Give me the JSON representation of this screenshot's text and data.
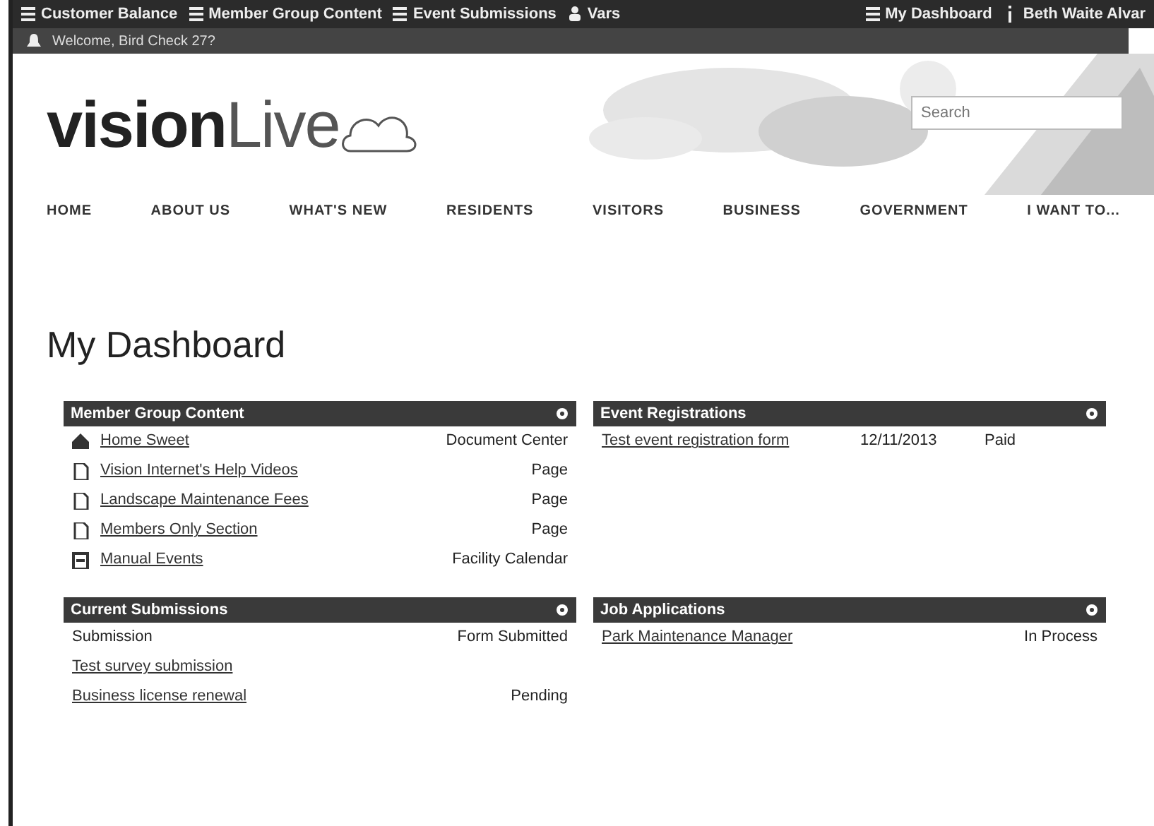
{
  "top_bar": {
    "left_links": [
      {
        "label": "Customer Balance"
      },
      {
        "label": "Member Group Content"
      },
      {
        "label": "Event Submissions"
      },
      {
        "label": "Vars"
      }
    ],
    "right_links": [
      {
        "label": "My Dashboard"
      },
      {
        "label": "Beth Waite Alvar"
      }
    ]
  },
  "notice_bar": {
    "text": "Welcome, Bird Check 27?"
  },
  "header": {
    "logo_bold": "vision",
    "logo_light": "Live",
    "search": {
      "placeholder": "Search"
    }
  },
  "nav": [
    {
      "label": "HOME"
    },
    {
      "label": "ABOUT US"
    },
    {
      "label": "WHAT'S NEW"
    },
    {
      "label": "RESIDENTS"
    },
    {
      "label": "VISITORS"
    },
    {
      "label": "BUSINESS"
    },
    {
      "label": "GOVERNMENT"
    },
    {
      "label": "I WANT TO..."
    }
  ],
  "page_title": "My Dashboard",
  "panels": [
    {
      "title": "Member Group Content",
      "kind": "content",
      "rows": [
        {
          "kind": "house",
          "cells": [
            "Home Sweet",
            "Document Center"
          ]
        },
        {
          "kind": "page",
          "cells": [
            "Vision Internet's Help Videos",
            "Page"
          ]
        },
        {
          "kind": "page",
          "cells": [
            "Landscape Maintenance Fees",
            "Page"
          ]
        },
        {
          "kind": "page",
          "cells": [
            "Members Only Section",
            "Page"
          ]
        },
        {
          "kind": "calendar",
          "cells": [
            "Manual Events",
            "Facility Calendar"
          ]
        }
      ]
    },
    {
      "title": "Event Registrations",
      "kind": "table",
      "rows": [
        {
          "cells": [
            "Test event registration form",
            "12/11/2013",
            "Paid"
          ]
        }
      ]
    },
    {
      "title": "Current Submissions",
      "kind": "table",
      "header": [
        "Submission",
        "Form Submitted"
      ],
      "rows": [
        {
          "cells": [
            "Test survey submission"
          ]
        },
        {
          "cells": [
            "Business license renewal",
            "Pending"
          ]
        }
      ]
    },
    {
      "title": "Job Applications",
      "kind": "table",
      "rows": [
        {
          "cells": [
            "Park Maintenance Manager",
            "In Process"
          ]
        }
      ]
    }
  ]
}
